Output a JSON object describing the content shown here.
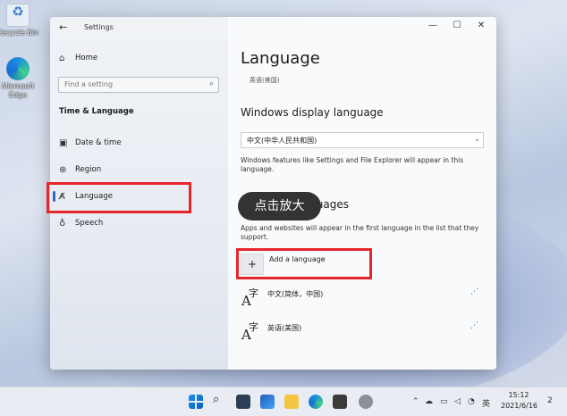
{
  "desktop": {
    "icons": [
      {
        "label": "Recycle Bin",
        "icon": "recycle-bin-icon"
      },
      {
        "label": "Microsoft Edge",
        "icon": "edge-icon"
      }
    ]
  },
  "window": {
    "title": "Settings",
    "controls": [
      "—",
      "☐",
      "✕"
    ]
  },
  "sidebar": {
    "home": "Home",
    "search_placeholder": "Find a setting",
    "section": "Time & Language",
    "items": [
      {
        "label": "Date & time",
        "icon": "calendar-clock-icon"
      },
      {
        "label": "Region",
        "icon": "globe-icon"
      },
      {
        "label": "Language",
        "icon": "language-icon",
        "selected": true
      },
      {
        "label": "Speech",
        "icon": "microphone-icon"
      }
    ]
  },
  "main": {
    "title": "Language",
    "subtitle": "英语(美国)",
    "display_heading": "Windows display language",
    "display_value": "中文(中华人民共和国)",
    "display_desc": "Windows features like Settings and File Explorer will appear in this language.",
    "preferred_heading": "Preferred languages",
    "preferred_desc": "Apps and websites will appear in the first language in the list that they support.",
    "add_language": "Add a language",
    "languages": [
      {
        "name": "中文(简体，中国)"
      },
      {
        "name": "英语(美国)"
      }
    ]
  },
  "overlay": {
    "tooltip": "点击放大"
  },
  "taskbar": {
    "time": "15:12",
    "date": "2021/6/16",
    "ime": "英",
    "notifications": "2"
  },
  "colors": {
    "highlight": "#e5262b",
    "accent": "#2b66c2"
  }
}
